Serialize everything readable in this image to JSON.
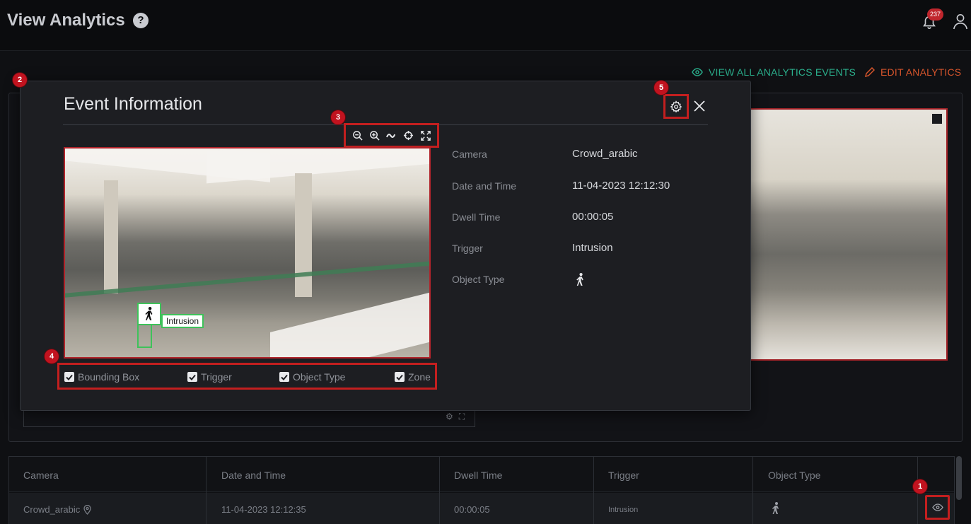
{
  "header": {
    "title": "View Analytics",
    "help_icon": "?",
    "notification_count": "237"
  },
  "actions": {
    "view_all": "VIEW ALL ANALYTICS EVENTS",
    "edit": "EDIT ANALYTICS"
  },
  "colors": {
    "accent_green": "#2bb08d",
    "accent_orange": "#d7552c",
    "highlight_red": "#c31f1f",
    "detection_green": "#3ec25a"
  },
  "modal": {
    "title": "Event Information",
    "snapshot": {
      "trigger_tag": "Intrusion"
    },
    "checkboxes": [
      {
        "label": "Bounding Box",
        "checked": true
      },
      {
        "label": "Trigger",
        "checked": true
      },
      {
        "label": "Object Type",
        "checked": true
      },
      {
        "label": "Zone",
        "checked": true
      }
    ],
    "info": [
      {
        "label": "Camera",
        "value": "Crowd_arabic"
      },
      {
        "label": "Date and Time",
        "value": "11-04-2023 12:12:30"
      },
      {
        "label": "Dwell Time",
        "value": "00:00:05"
      },
      {
        "label": "Trigger",
        "value": "Intrusion"
      },
      {
        "label": "Object Type",
        "value": ""
      }
    ],
    "toolbar_icons": [
      "zoom-out-icon",
      "zoom-in-icon",
      "wave-icon",
      "crosshair-icon",
      "fullscreen-icon"
    ]
  },
  "table": {
    "headers": [
      "Camera",
      "Date and Time",
      "Dwell Time",
      "Trigger",
      "Object Type"
    ],
    "rows": [
      {
        "camera": "Crowd_arabic",
        "datetime": "11-04-2023 12:12:35",
        "dwell": "00:00:05",
        "trigger": "Intrusion"
      }
    ]
  },
  "markers": [
    "1",
    "2",
    "3",
    "4",
    "5"
  ]
}
